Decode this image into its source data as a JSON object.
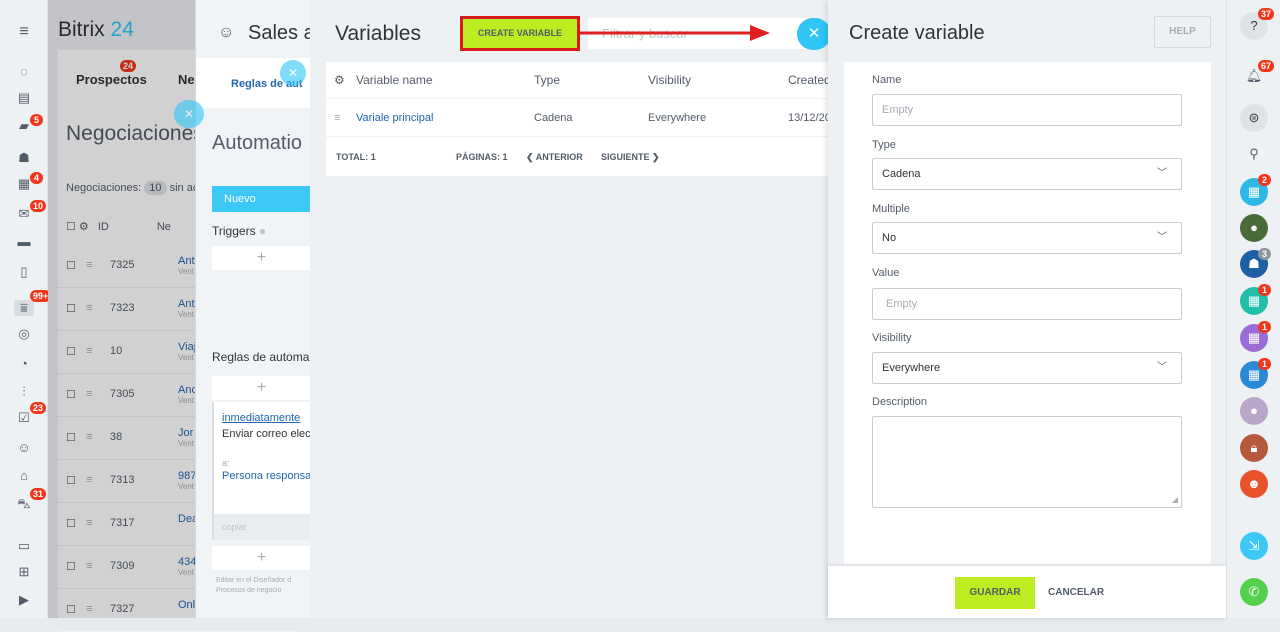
{
  "bitrix": {
    "logo_a": "Bitrix",
    "logo_b": "24"
  },
  "left_nav": {
    "badges": [
      "5",
      "4",
      "10",
      "99+",
      "23",
      "31"
    ]
  },
  "crm": {
    "tabs": [
      {
        "label": "Prospectos",
        "badge": "24"
      },
      {
        "label": "Ne"
      }
    ],
    "title": "Negociaciones",
    "count_text": "Negociaciones:",
    "count": "10",
    "count_suffix": "sin ac",
    "header_id": "ID",
    "header_name": "Ne",
    "rows": [
      {
        "id": "7325",
        "name": "Ant",
        "sub": "Vent"
      },
      {
        "id": "7323",
        "name": "Ant",
        "sub": "Vent"
      },
      {
        "id": "10",
        "name": "Viaj",
        "sub": "Vent"
      },
      {
        "id": "7305",
        "name": "Anc",
        "sub": "Vent"
      },
      {
        "id": "38",
        "name": "Jor",
        "sub": "Vent"
      },
      {
        "id": "7313",
        "name": "987",
        "sub": "Vent"
      },
      {
        "id": "7317",
        "name": "Dea",
        "sub": ""
      },
      {
        "id": "7309",
        "name": "434",
        "sub": "Vent"
      },
      {
        "id": "7327",
        "name": "Onl",
        "sub": ""
      }
    ]
  },
  "sales": {
    "title": "Sales a",
    "tab": "Reglas de aut",
    "automation": "Automatio",
    "nuevo": "Nuevo",
    "triggers": "Triggers",
    "reglas": "Reglas de automa",
    "plus": "+",
    "rule_when": "inmediatamente",
    "rule_action": "Enviar correo elec",
    "rule_to": "a:",
    "rule_person": "Persona responsa",
    "copiar": "copiar",
    "footer_text": "Editar en el Diseñador d Procesos de negocio"
  },
  "variables": {
    "title": "Variables",
    "create_button": "CREATE VARIABLE",
    "filter_placeholder": "Filtrar y buscar",
    "columns": [
      "Variable name",
      "Type",
      "Visibility",
      "Created"
    ],
    "rows": [
      {
        "name": "Variale principal",
        "type": "Cadena",
        "visibility": "Everywhere",
        "created": "13/12/20"
      }
    ],
    "total_label": "TOTAL:",
    "total": "1",
    "pages_label": "PÁGINAS:",
    "pages": "1",
    "prev": "ANTERIOR",
    "next": "SIGUIENTE"
  },
  "create_variable": {
    "title": "Create variable",
    "help": "HELP",
    "fields": {
      "name_label": "Name",
      "name_placeholder": "Empty",
      "type_label": "Type",
      "type_value": "Cadena",
      "multiple_label": "Multiple",
      "multiple_value": "No",
      "value_label": "Value",
      "value_placeholder": "Empty",
      "visibility_label": "Visibility",
      "visibility_value": "Everywhere",
      "description_label": "Description"
    },
    "save": "GUARDAR",
    "cancel": "CANCELAR"
  },
  "right_bar": {
    "help_badge": "37",
    "bell_badge": "67",
    "badges": [
      "2",
      "3",
      "1",
      "1",
      "1"
    ]
  },
  "colors": {
    "accent": "#2fc6f6",
    "save_green": "#bbed21",
    "highlight_red": "#d81b1b",
    "badge_red": "#f0371b"
  }
}
